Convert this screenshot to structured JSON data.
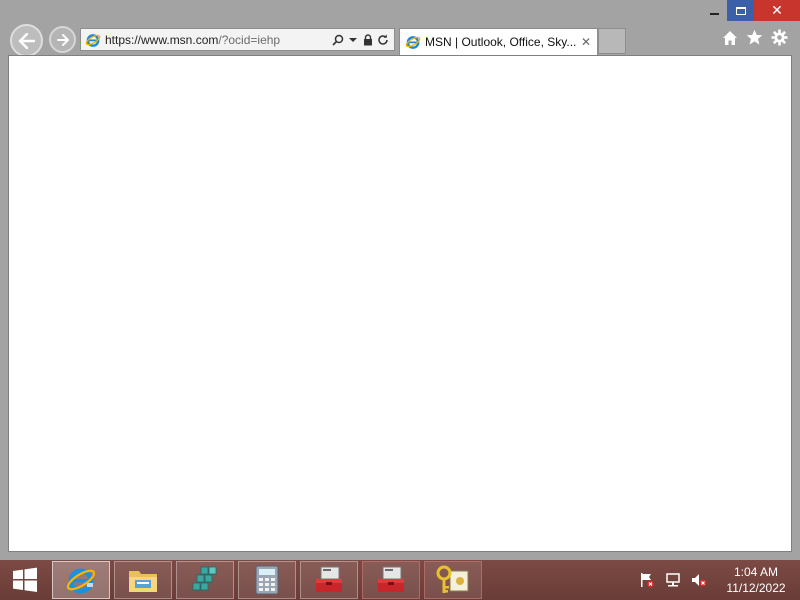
{
  "browser": {
    "address": {
      "url_main": "https://www.msn.com",
      "url_dim": "/?ocid=iehp"
    },
    "tab": {
      "title": "MSN | Outlook, Office, Sky...",
      "close_glyph": "✕"
    },
    "caption": {
      "close_glyph": "✕"
    },
    "icons": [
      "back-arrow-icon",
      "forward-arrow-icon",
      "ie-icon",
      "search-icon",
      "dropdown-icon",
      "lock-icon",
      "refresh-icon",
      "home-icon",
      "star-icon",
      "gear-icon"
    ]
  },
  "taskbar": {
    "apps": [
      {
        "name": "internet-explorer",
        "icon": "ie-icon"
      },
      {
        "name": "file-explorer",
        "icon": "folder-icon"
      },
      {
        "name": "server-manager",
        "icon": "cubes-icon"
      },
      {
        "name": "calculator",
        "icon": "calculator-icon"
      },
      {
        "name": "toolbox-1",
        "icon": "toolbox-icon"
      },
      {
        "name": "toolbox-2",
        "icon": "toolbox-icon"
      },
      {
        "name": "certificates",
        "icon": "key-certificate-icon"
      }
    ],
    "clock": {
      "time": "1:04 AM",
      "date": "11/12/2022"
    },
    "tray": [
      "flag-icon",
      "network-icon",
      "speaker-muted-icon"
    ]
  },
  "colors": {
    "window_frame": "#a3a3a3",
    "close_button": "#c7352c",
    "maximize_button": "#3b5fa8",
    "taskbar": "#6f403b",
    "content": "#ffffff"
  }
}
